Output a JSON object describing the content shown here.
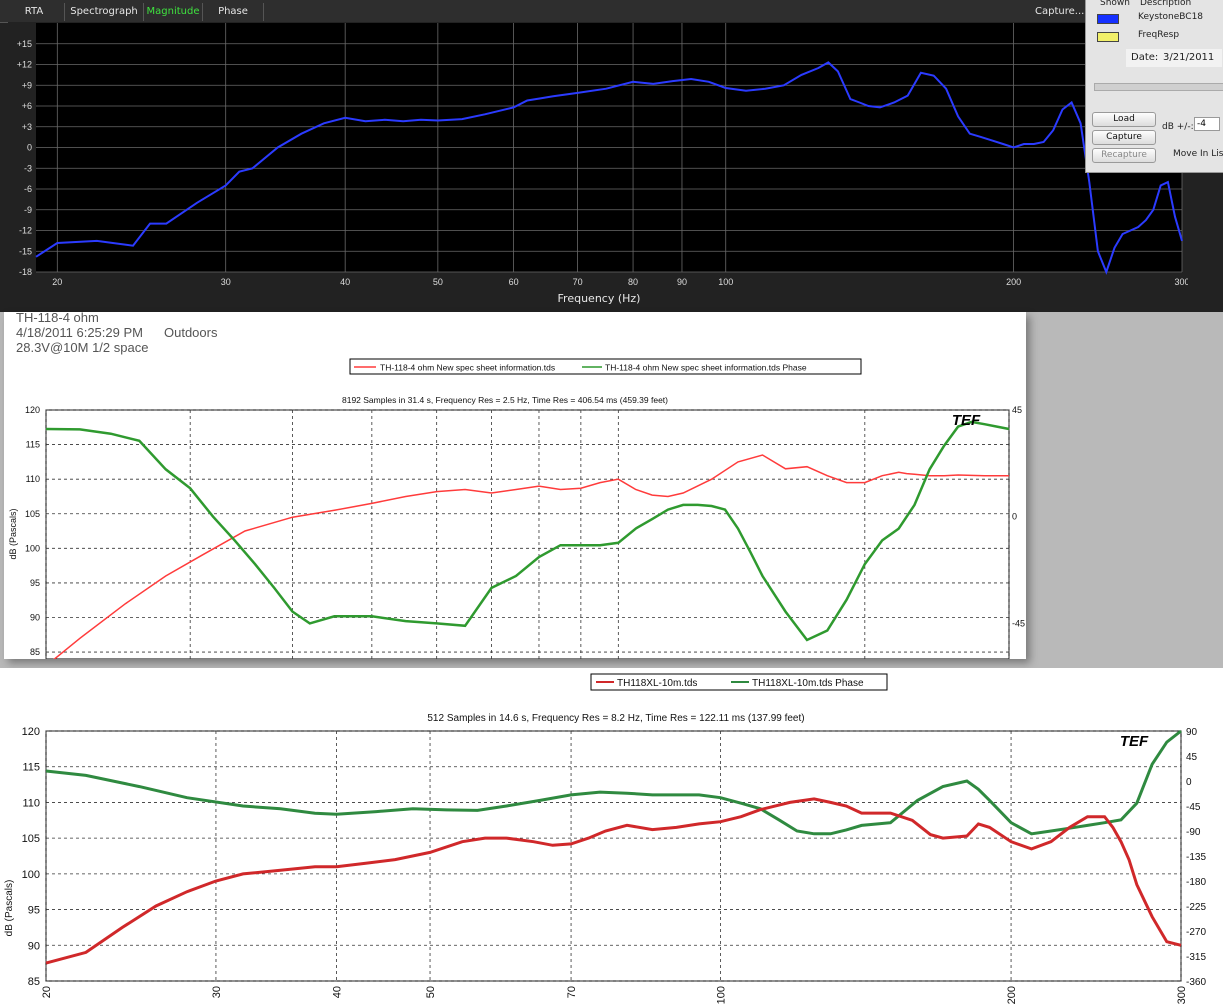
{
  "analyzer": {
    "tabs": [
      {
        "label": "RTA",
        "active": false
      },
      {
        "label": "Spectrograph",
        "active": false
      },
      {
        "label": "Magnitude",
        "active": true
      },
      {
        "label": "Phase",
        "active": false
      }
    ],
    "capture_tab": "Capture...",
    "xlabel": "Frequency (Hz)",
    "colors": {
      "trace": "#2b3bff",
      "active_tab": "#3fe23f"
    }
  },
  "side_panel": {
    "col_shown": "Shown",
    "col_description": "Description",
    "items": [
      {
        "label": "KeystoneBC18",
        "color": "#1530ff"
      },
      {
        "label": "FreqResp",
        "color": "#f2f06a"
      }
    ],
    "date_label": "Date:",
    "date_value": "3/21/2011",
    "load_button": "Load",
    "capture_button": "Capture",
    "recapture_button": "Recapture",
    "db_label": "dB +/-:",
    "db_value": "-4",
    "move_label": "Move In Lis"
  },
  "panel1": {
    "title": "TH-118-4 ohm",
    "datetime": "4/18/2011 6:25:29 PM",
    "location": "Outdoors",
    "condition": "28.3V@10M 1/2 space",
    "legend": [
      "TH-118-4 ohm New spec sheet information.tds",
      "TH-118-4 ohm New spec sheet information.tds Phase"
    ],
    "subtitle": "8192 Samples in 31.4 s, Frequency Res = 2.5 Hz, Time Res = 406.54 ms (459.39 feet)",
    "ylabel": "dB (Pascals)",
    "logo": "TEF"
  },
  "panel2": {
    "legend": [
      "TH118XL-10m.tds",
      "TH118XL-10m.tds Phase"
    ],
    "subtitle": "512 Samples in 14.6 s, Frequency Res = 8.2 Hz, Time Res = 122.11 ms (137.99 feet)",
    "ylabel": "dB (Pascals)",
    "logo": "TEF"
  },
  "chart_data": [
    {
      "type": "line",
      "x_scale": "log",
      "xlim": [
        19,
        300
      ],
      "ylim": [
        -18,
        18
      ],
      "xlabel": "Frequency (Hz)",
      "x_ticks": [
        20,
        30,
        40,
        50,
        60,
        70,
        80,
        90,
        100,
        200,
        300
      ],
      "y_ticks": [
        -18,
        -15,
        -12,
        -9,
        -6,
        -3,
        0,
        3,
        6,
        9,
        12,
        15
      ],
      "y_tick_labels": [
        "-18",
        "-15",
        "-12",
        "-9",
        "-6",
        "-3",
        "0",
        "+3",
        "+6",
        "+9",
        "+12",
        "+15"
      ],
      "grid": true,
      "series": [
        {
          "name": "KeystoneBC18",
          "color": "#2b3bff",
          "x": [
            19,
            20,
            22,
            24,
            25,
            26,
            28,
            30,
            31,
            32,
            34,
            36,
            38,
            40,
            42,
            44,
            46,
            48,
            50,
            53,
            56,
            60,
            62,
            64,
            66,
            70,
            75,
            80,
            84,
            88,
            92,
            96,
            100,
            105,
            110,
            115,
            120,
            125,
            128,
            131,
            135,
            138,
            141,
            145,
            150,
            155,
            160,
            165,
            170,
            175,
            180,
            185,
            190,
            195,
            200,
            205,
            210,
            215,
            220,
            225,
            230,
            235,
            240,
            245,
            250,
            255,
            260,
            265,
            270,
            275,
            280,
            285,
            290,
            295,
            300
          ],
          "y": [
            -15.8,
            -13.8,
            -13.5,
            -14.2,
            -11.0,
            -11.0,
            -8.0,
            -5.5,
            -3.5,
            -3.0,
            0.0,
            2.0,
            3.5,
            4.3,
            3.8,
            4.0,
            3.8,
            4.0,
            3.9,
            4.1,
            4.8,
            5.8,
            6.8,
            7.1,
            7.4,
            7.9,
            8.5,
            9.5,
            9.2,
            9.6,
            9.9,
            9.5,
            8.6,
            8.2,
            8.5,
            9.0,
            10.5,
            11.5,
            12.3,
            11.0,
            7.0,
            6.5,
            6.0,
            5.8,
            6.5,
            7.5,
            10.8,
            10.4,
            8.5,
            4.5,
            2.0,
            1.5,
            1.0,
            0.5,
            0.0,
            0.5,
            0.5,
            0.8,
            2.5,
            5.5,
            6.5,
            3.5,
            -5.0,
            -15.0,
            -18.0,
            -14.5,
            -12.5,
            -12.0,
            -11.5,
            -10.5,
            -9.0,
            -5.5,
            -5.0,
            -10.0,
            -13.5
          ]
        }
      ]
    },
    {
      "type": "line",
      "x_scale": "log",
      "xlim": [
        20,
        300
      ],
      "ylim": [
        84,
        120
      ],
      "y2lim": [
        -60,
        45
      ],
      "ylabel": "dB (Pascals)",
      "x_ticks": [
        20,
        30,
        40,
        50,
        60,
        70,
        80,
        90,
        100,
        200,
        300
      ],
      "y_ticks": [
        85,
        90,
        95,
        100,
        105,
        110,
        115,
        120
      ],
      "y2_ticks": [
        -45,
        0,
        45
      ],
      "grid": true,
      "series": [
        {
          "name": "TH-118-4 ohm New spec sheet information.tds",
          "color": "#ff3b3b",
          "axis": "left",
          "x": [
            20,
            22,
            25,
            28,
            31,
            35,
            40,
            45,
            50,
            55,
            60,
            65,
            70,
            75,
            80,
            85,
            90,
            95,
            100,
            105,
            110,
            115,
            120,
            130,
            140,
            150,
            160,
            170,
            180,
            190,
            200,
            210,
            220,
            225,
            230,
            240,
            250,
            260,
            280,
            300
          ],
          "y": [
            83.0,
            87.0,
            92.0,
            96.0,
            99.0,
            102.5,
            104.5,
            105.5,
            106.5,
            107.5,
            108.2,
            108.5,
            108.0,
            108.5,
            109.0,
            108.5,
            108.7,
            109.5,
            110.0,
            108.5,
            107.7,
            107.5,
            108.0,
            110.0,
            112.5,
            113.5,
            111.5,
            111.8,
            110.5,
            109.5,
            109.5,
            110.5,
            111.0,
            110.8,
            110.7,
            110.5,
            110.5,
            110.6,
            110.5,
            110.5
          ]
        },
        {
          "name": "TH-118-4 ohm New spec sheet information.tds Phase",
          "color": "#2f9a2f",
          "axis": "right",
          "x": [
            20,
            22,
            24,
            26,
            28,
            30,
            32,
            34,
            36,
            38,
            40,
            42,
            45,
            48,
            50,
            55,
            60,
            65,
            70,
            75,
            80,
            85,
            90,
            95,
            100,
            105,
            110,
            115,
            120,
            125,
            130,
            135,
            140,
            145,
            150,
            160,
            170,
            180,
            190,
            200,
            210,
            220,
            230,
            240,
            250,
            260,
            270,
            280,
            290,
            300
          ],
          "y": [
            37.0,
            36.8,
            35.0,
            32.0,
            20.0,
            12.0,
            0.0,
            -10.0,
            -20.0,
            -30.0,
            -40.0,
            -45.0,
            -42.0,
            -42.0,
            -42.0,
            -44.0,
            -45.0,
            -46.0,
            -30.0,
            -25.0,
            -17.0,
            -12.0,
            -12.0,
            -12.0,
            -11.0,
            -5.0,
            -1.0,
            3.0,
            5.0,
            5.0,
            4.5,
            3.0,
            -5.0,
            -15.0,
            -25.0,
            -40.0,
            -52.0,
            -48.0,
            -35.0,
            -20.0,
            -10.0,
            -5.0,
            5.0,
            20.0,
            30.0,
            38.0,
            40.0,
            39.0,
            38.0,
            37.0
          ]
        }
      ]
    },
    {
      "type": "line",
      "x_scale": "log",
      "xlim": [
        20,
        300
      ],
      "ylim": [
        85,
        120
      ],
      "y2lim": [
        -360,
        90
      ],
      "ylabel": "dB (Pascals)",
      "x_ticks": [
        20,
        30,
        40,
        50,
        70,
        100,
        200,
        300
      ],
      "y_ticks": [
        85,
        90,
        95,
        100,
        105,
        110,
        115,
        120
      ],
      "y2_ticks": [
        -360,
        -315,
        -270,
        -225,
        -180,
        -135,
        -90,
        -45,
        0,
        45,
        90
      ],
      "grid": true,
      "series": [
        {
          "name": "TH118XL-10m.tds",
          "color": "#d0282a",
          "axis": "left",
          "x": [
            20,
            22,
            24,
            26,
            28,
            30,
            32,
            35,
            38,
            40,
            43,
            46,
            50,
            54,
            57,
            60,
            64,
            67,
            70,
            73,
            76,
            80,
            85,
            90,
            95,
            100,
            105,
            110,
            118,
            125,
            130,
            135,
            140,
            150,
            158,
            165,
            170,
            180,
            185,
            190,
            200,
            210,
            220,
            230,
            240,
            250,
            255,
            260,
            265,
            270,
            280,
            290,
            300
          ],
          "y": [
            87.5,
            89.0,
            92.5,
            95.5,
            97.5,
            99.0,
            100.0,
            100.5,
            101.0,
            101.0,
            101.5,
            102.0,
            103.0,
            104.5,
            105.0,
            105.0,
            104.5,
            104.0,
            104.2,
            105.0,
            106.0,
            106.8,
            106.2,
            106.5,
            107.0,
            107.3,
            108.0,
            109.0,
            110.0,
            110.5,
            110.0,
            109.5,
            108.5,
            108.5,
            107.5,
            105.5,
            105.0,
            105.3,
            107.0,
            106.5,
            104.5,
            103.5,
            104.5,
            106.5,
            108.0,
            108.0,
            106.5,
            104.5,
            102.0,
            98.5,
            94.0,
            90.5,
            90.0
          ]
        },
        {
          "name": "TH118XL-10m.tds Phase",
          "color": "#2f8a40",
          "axis": "right",
          "x": [
            20,
            22,
            25,
            28,
            32,
            35,
            38,
            40,
            44,
            48,
            52,
            56,
            60,
            65,
            70,
            75,
            80,
            85,
            90,
            95,
            100,
            105,
            110,
            115,
            120,
            125,
            130,
            135,
            140,
            150,
            160,
            170,
            180,
            185,
            190,
            200,
            210,
            220,
            230,
            240,
            250,
            260,
            270,
            280,
            290,
            300
          ],
          "y": [
            18.0,
            10.0,
            -10.0,
            -30.0,
            -45.0,
            -50.0,
            -58.0,
            -60.0,
            -55.0,
            -50.0,
            -52.0,
            -53.0,
            -45.0,
            -35.0,
            -25.0,
            -20.0,
            -22.0,
            -25.0,
            -25.0,
            -25.0,
            -30.0,
            -40.0,
            -50.0,
            -70.0,
            -90.0,
            -95.0,
            -95.0,
            -88.0,
            -80.0,
            -75.0,
            -35.0,
            -10.0,
            0.0,
            -15.0,
            -35.0,
            -75.0,
            -95.0,
            -90.0,
            -85.0,
            -80.0,
            -75.0,
            -70.0,
            -40.0,
            30.0,
            70.0,
            90.0
          ]
        }
      ]
    }
  ]
}
